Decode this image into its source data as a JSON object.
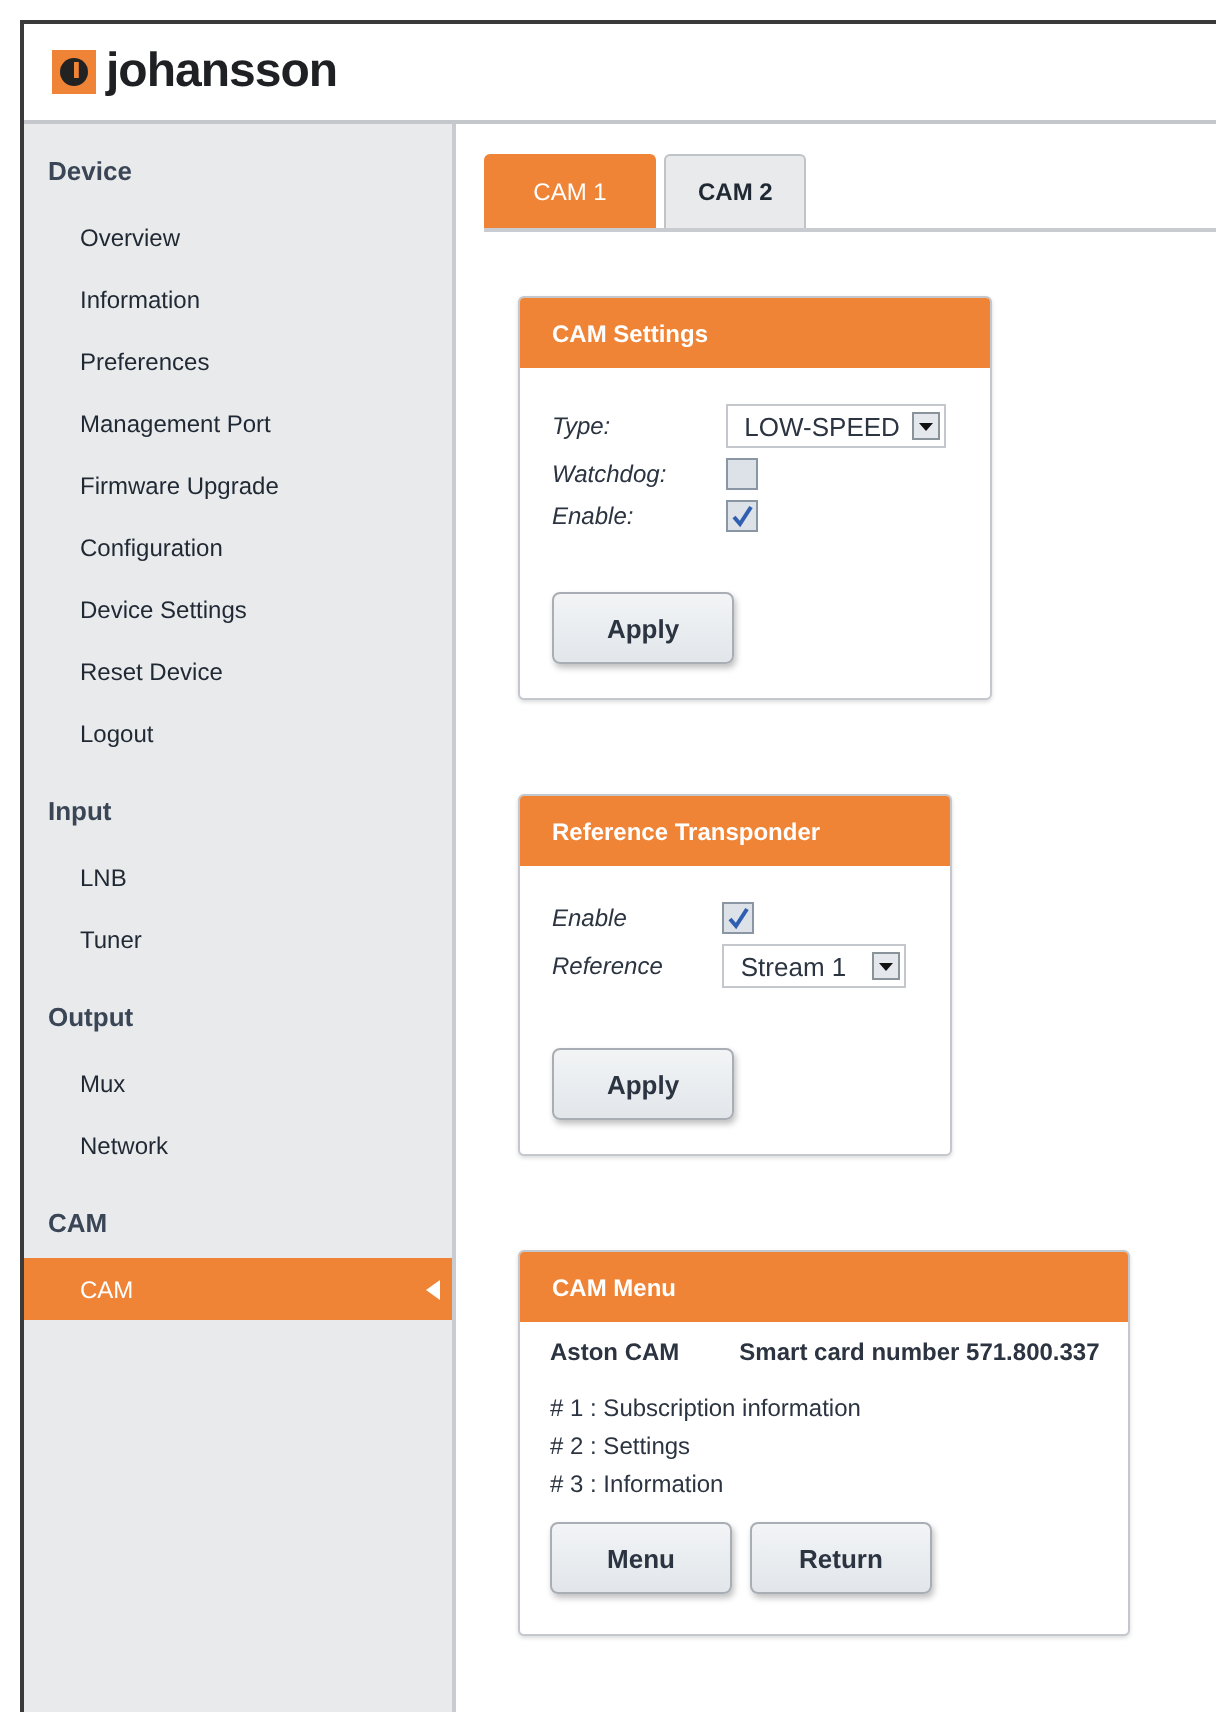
{
  "brand": {
    "name": "johansson"
  },
  "sidebar": {
    "sections": [
      {
        "title": "Device",
        "items": [
          {
            "label": "Overview",
            "selected": false
          },
          {
            "label": "Information",
            "selected": false
          },
          {
            "label": "Preferences",
            "selected": false
          },
          {
            "label": "Management Port",
            "selected": false
          },
          {
            "label": "Firmware Upgrade",
            "selected": false
          },
          {
            "label": "Configuration",
            "selected": false
          },
          {
            "label": "Device Settings",
            "selected": false
          },
          {
            "label": "Reset Device",
            "selected": false
          },
          {
            "label": "Logout",
            "selected": false
          }
        ]
      },
      {
        "title": "Input",
        "items": [
          {
            "label": "LNB",
            "selected": false
          },
          {
            "label": "Tuner",
            "selected": false
          }
        ]
      },
      {
        "title": "Output",
        "items": [
          {
            "label": "Mux",
            "selected": false
          },
          {
            "label": "Network",
            "selected": false
          }
        ]
      },
      {
        "title": "CAM",
        "items": [
          {
            "label": "CAM",
            "selected": true
          }
        ]
      }
    ]
  },
  "tabs": [
    {
      "label": "CAM 1",
      "selected": true
    },
    {
      "label": "CAM 2",
      "selected": false
    }
  ],
  "panels": [
    {
      "title": "CAM Settings",
      "fields": [
        {
          "kind": "select",
          "label": "Type:",
          "value": "LOW-SPEED"
        },
        {
          "kind": "checkbox",
          "label": "Watchdog:",
          "checked": false
        },
        {
          "kind": "checkbox",
          "label": "Enable:",
          "checked": true
        }
      ],
      "buttons": [
        "Apply"
      ]
    },
    {
      "title": "Reference Transponder",
      "fields": [
        {
          "kind": "checkbox",
          "label": "Enable",
          "checked": true
        },
        {
          "kind": "select",
          "label": "Reference",
          "value": "Stream 1"
        }
      ],
      "buttons": [
        "Apply"
      ]
    },
    {
      "title": "CAM Menu",
      "info": {
        "name": "Aston CAM",
        "card": "Smart card number 571.800.337"
      },
      "menu_lines": [
        "# 1 : Subscription information",
        "# 2 : Settings",
        "# 3 : Information"
      ],
      "buttons": [
        "Menu",
        "Return"
      ]
    }
  ]
}
